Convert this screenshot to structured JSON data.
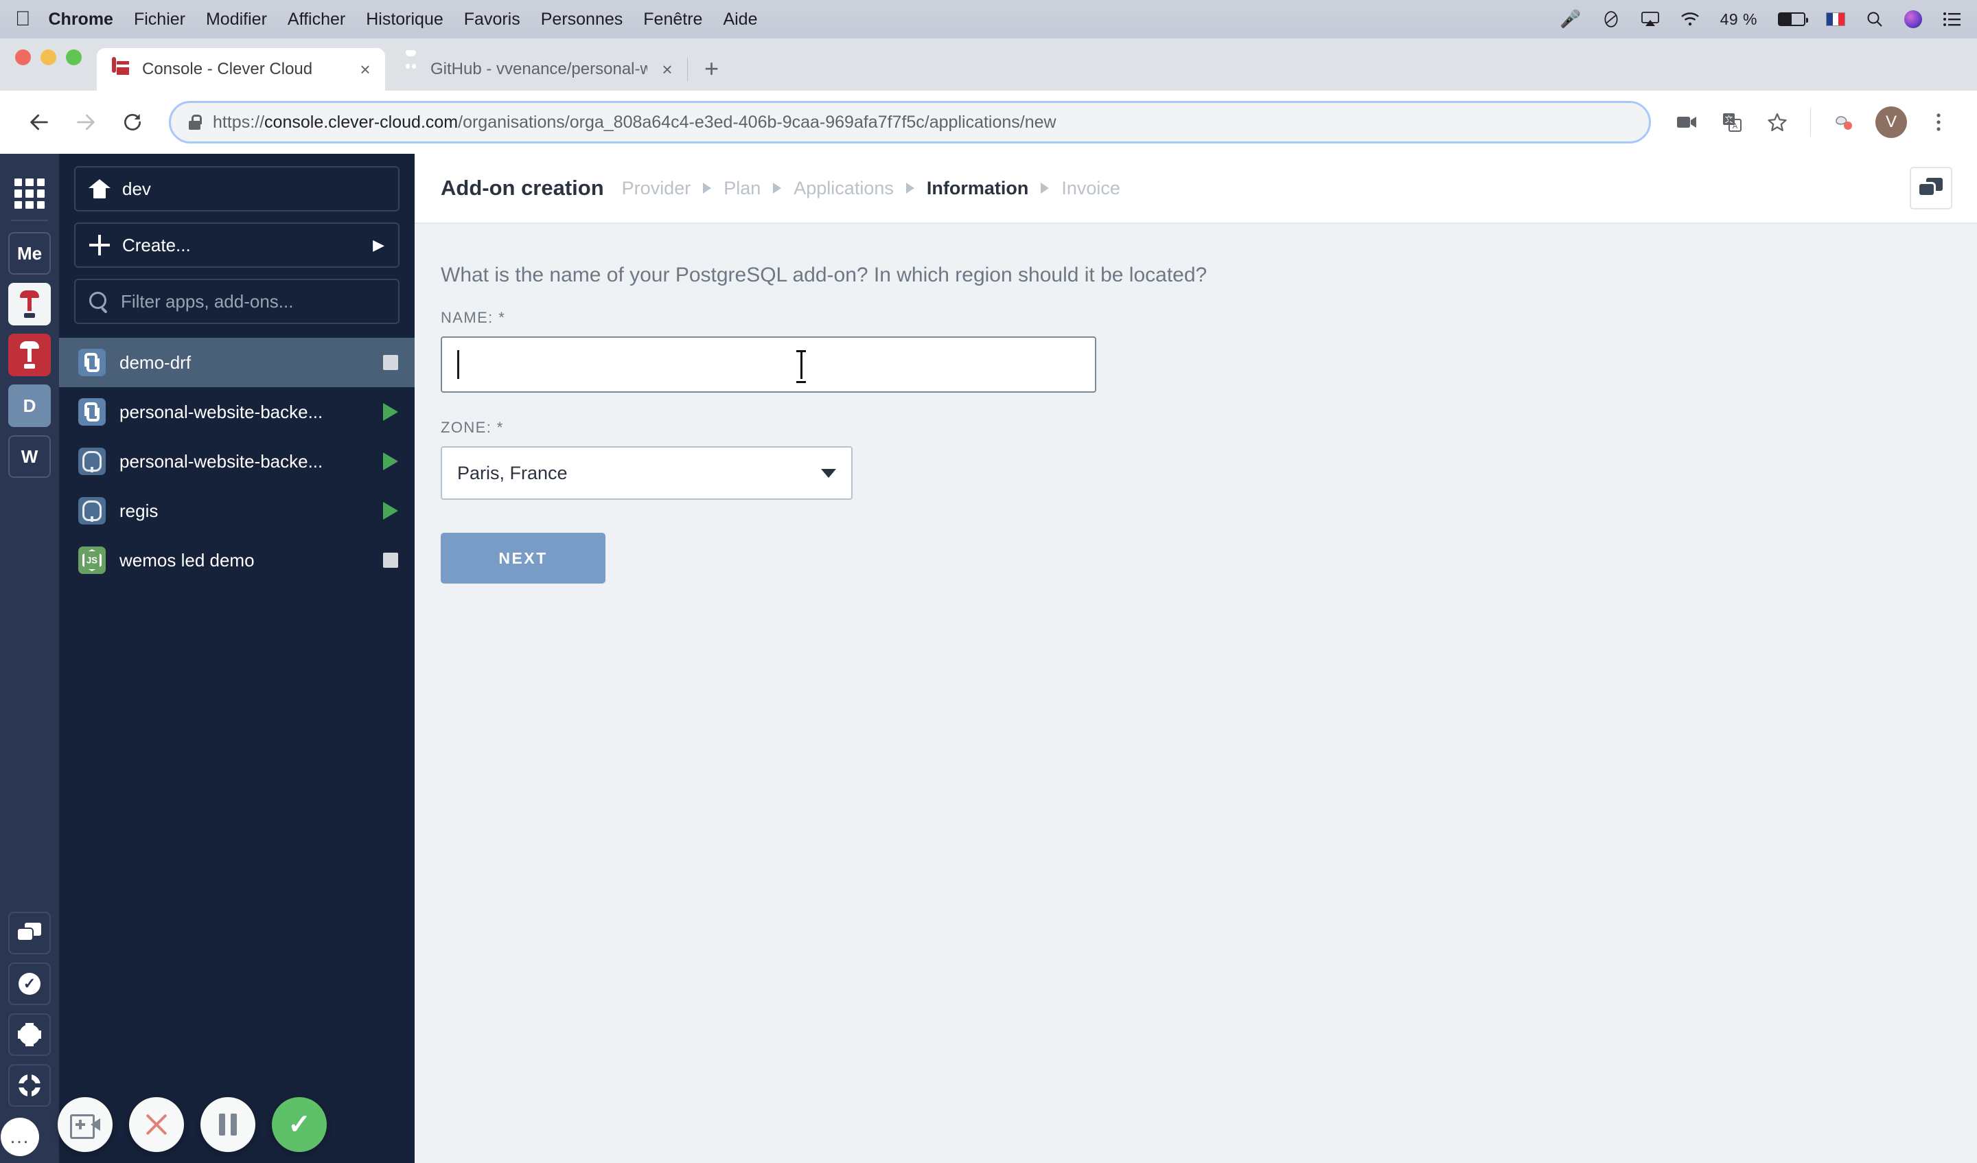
{
  "menubar": {
    "apple_icon": "apple-logo-icon",
    "items": [
      "Chrome",
      "Fichier",
      "Modifier",
      "Afficher",
      "Historique",
      "Favoris",
      "Personnes",
      "Fenêtre",
      "Aide"
    ],
    "status": {
      "mic_icon": "microphone-icon",
      "dnd_icon": "do-not-disturb-icon",
      "airplay_icon": "airplay-icon",
      "wifi_icon": "wifi-icon",
      "battery_percent": "49 %",
      "battery_icon": "battery-icon",
      "input_flag": "french-flag-icon",
      "search_icon": "spotlight-search-icon",
      "siri_icon": "siri-icon",
      "control_center_icon": "control-center-icon"
    }
  },
  "browser": {
    "tabs": [
      {
        "title": "Console - Clever Cloud",
        "favicon": "clever-cloud-favicon",
        "active": true,
        "close_label": "×"
      },
      {
        "title": "GitHub - vvenance/personal-w",
        "favicon": "github-favicon",
        "active": false,
        "close_label": "×"
      }
    ],
    "new_tab_label": "+",
    "nav": {
      "back_icon": "back-arrow-icon",
      "forward_icon": "forward-arrow-icon",
      "reload_icon": "reload-icon"
    },
    "omnibox": {
      "lock_icon": "lock-icon",
      "url_scheme": "https://",
      "url_host": "console.clever-cloud.com",
      "url_path": "/organisations/orga_808a64c4-e3ed-406b-9caa-969afa7f7f5c/applications/new"
    },
    "toolbar_icons": {
      "video_icon": "video-camera-icon",
      "translate_icon": "translate-icon",
      "bookmark_icon": "star-bookmark-icon",
      "extension_icon": "extension-icon",
      "avatar_label": "V",
      "menu_icon": "three-dot-menu-icon"
    }
  },
  "rail": {
    "apps_grid_icon": "apps-grid-icon",
    "org_tiles": [
      {
        "label": "Me",
        "style": "plain",
        "name": "org-tile-me"
      },
      {
        "label": "",
        "style": "white",
        "name": "org-tile-clever-white"
      },
      {
        "label": "",
        "style": "red",
        "name": "org-tile-clever-red"
      },
      {
        "label": "D",
        "style": "active",
        "name": "org-tile-dev"
      },
      {
        "label": "W",
        "style": "plain",
        "name": "org-tile-w"
      }
    ],
    "bottom_icons": [
      {
        "icon": "chat-bubbles-icon",
        "name": "rail-button-chat"
      },
      {
        "icon": "check-circle-icon",
        "name": "rail-button-status"
      },
      {
        "icon": "gear-icon",
        "name": "rail-button-settings"
      },
      {
        "icon": "life-ring-icon",
        "name": "rail-button-help"
      }
    ],
    "more_label": "…"
  },
  "sidebar": {
    "org_name": "dev",
    "org_home_icon": "home-icon",
    "create_label": "Create...",
    "create_plus_icon": "plus-icon",
    "create_caret": "▶",
    "filter_placeholder": "Filter apps, add-ons...",
    "filter_icon": "search-icon",
    "apps": [
      {
        "name": "demo-drf",
        "type": "python",
        "status": "stopped",
        "selected": true
      },
      {
        "name": "personal-website-backe...",
        "type": "python",
        "status": "running",
        "selected": false
      },
      {
        "name": "personal-website-backe...",
        "type": "postgresql",
        "status": "running",
        "selected": false
      },
      {
        "name": "regis",
        "type": "postgresql",
        "status": "running",
        "selected": false
      },
      {
        "name": "wemos led demo",
        "type": "node",
        "status": "stopped",
        "selected": false
      }
    ]
  },
  "content": {
    "title": "Add-on creation",
    "breadcrumbs": [
      {
        "label": "Provider",
        "active": false
      },
      {
        "label": "Plan",
        "active": false
      },
      {
        "label": "Applications",
        "active": false
      },
      {
        "label": "Information",
        "active": true
      },
      {
        "label": "Invoice",
        "active": false
      }
    ],
    "feedback_icon": "chat-bubbles-icon",
    "question": "What is the name of your PostgreSQL add-on? In which region should it be located?",
    "name_field": {
      "label": "NAME:",
      "required_mark": "*",
      "value": "",
      "placeholder": ""
    },
    "zone_field": {
      "label": "ZONE:",
      "required_mark": "*",
      "value": "Paris, France",
      "caret": "▼"
    },
    "next_button": "NEXT"
  },
  "recorder": {
    "add_video_icon": "add-video-icon",
    "cancel_icon": "close-x-icon",
    "pause_icon": "pause-icon",
    "finish_icon": "checkmark-icon"
  },
  "colors": {
    "rail_bg": "#2b3752",
    "sidebar_bg": "#16213a",
    "selected_row": "#4a6079",
    "content_bg": "#eef2f5",
    "accent_button": "#789cc6",
    "clever_red": "#c0303b",
    "running_green": "#4aa657"
  }
}
